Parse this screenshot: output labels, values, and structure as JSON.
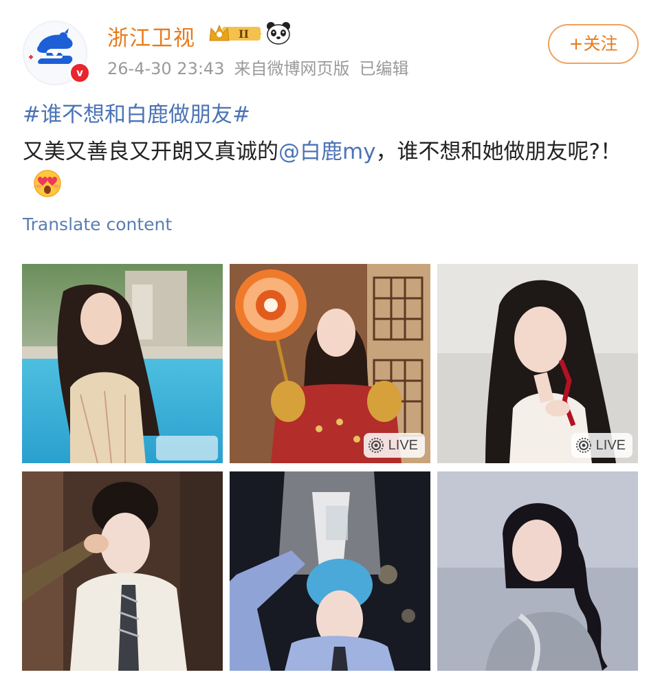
{
  "header": {
    "user_name": "浙江卫视",
    "level_badge_text": "II",
    "badge_icon": "crown-icon",
    "verified_icon": "v",
    "timestamp": "26-4-30 23:43",
    "source": "来自微博网页版",
    "edited": "已编辑",
    "follow_label": "+关注"
  },
  "post": {
    "hashtag": "#谁不想和白鹿做朋友#",
    "text_before": "又美又善良又开朗又真诚的",
    "mention": "@白鹿my",
    "text_after": "，谁不想和她做朋友呢?！",
    "emoji": "heart-eyes-face-icon",
    "translate_label": "Translate content"
  },
  "images": [
    {
      "name": "photo-1",
      "badge": ""
    },
    {
      "name": "photo-2",
      "badge": "LIVE"
    },
    {
      "name": "photo-3",
      "badge": "LIVE"
    },
    {
      "name": "photo-4",
      "badge": ""
    },
    {
      "name": "photo-5",
      "badge": ""
    },
    {
      "name": "photo-6",
      "badge": ""
    }
  ],
  "colors": {
    "username": "#e87a1b",
    "link": "#4b73b5",
    "meta": "#9a9a9a",
    "follow_border": "#f0a15a"
  }
}
